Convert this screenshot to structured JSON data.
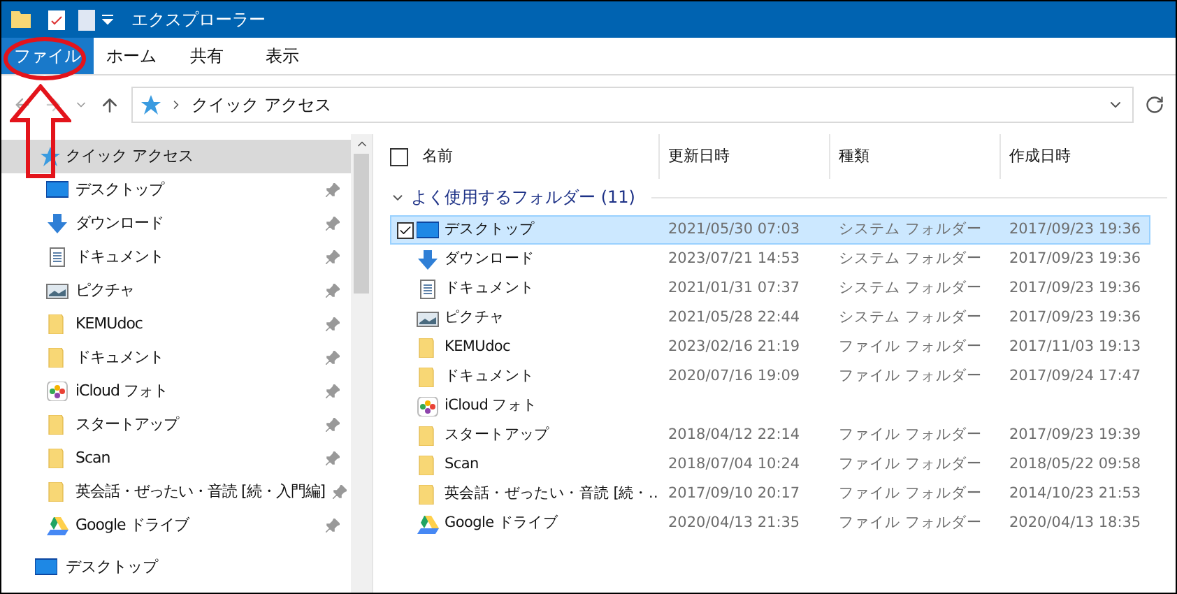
{
  "window": {
    "title": "エクスプローラー"
  },
  "ribbon_tabs": [
    {
      "label": "ファイル",
      "selected": true
    },
    {
      "label": "ホーム",
      "selected": false
    },
    {
      "label": "共有",
      "selected": false
    },
    {
      "label": "表示",
      "selected": false
    }
  ],
  "address_bar": {
    "path": "クイック アクセス"
  },
  "sidebar": {
    "header": {
      "label": "クイック アクセス",
      "selected": true
    },
    "items": [
      {
        "label": "デスクトップ",
        "kind": "desktop",
        "pinned": true
      },
      {
        "label": "ダウンロード",
        "kind": "download",
        "pinned": true
      },
      {
        "label": "ドキュメント",
        "kind": "document",
        "pinned": true
      },
      {
        "label": "ピクチャ",
        "kind": "picture",
        "pinned": true
      },
      {
        "label": "KEMUdoc",
        "kind": "folder",
        "pinned": true
      },
      {
        "label": "ドキュメント",
        "kind": "folder",
        "pinned": true
      },
      {
        "label": "iCloud フォト",
        "kind": "photos",
        "pinned": true
      },
      {
        "label": "スタートアップ",
        "kind": "folder",
        "pinned": true
      },
      {
        "label": "Scan",
        "kind": "folder",
        "pinned": true
      },
      {
        "label": "英会話・ぜったい・音読 [続・入門編]",
        "kind": "folder",
        "pinned": true
      },
      {
        "label": "Google ドライブ",
        "kind": "drive",
        "pinned": true
      }
    ],
    "footer": {
      "label": "デスクトップ",
      "kind": "desktop"
    }
  },
  "table": {
    "all_checked": false,
    "columns": [
      "名前",
      "更新日時",
      "種類",
      "作成日時"
    ],
    "group": "よく使用するフォルダー (11)",
    "rows": [
      {
        "name": "デスクトップ",
        "kind": "desktop",
        "modified": "2021/05/30 07:03",
        "type": "システム フォルダー",
        "created": "2017/09/23 19:36",
        "selected": true
      },
      {
        "name": "ダウンロード",
        "kind": "download",
        "modified": "2023/07/21 14:53",
        "type": "システム フォルダー",
        "created": "2017/09/23 19:36",
        "selected": false
      },
      {
        "name": "ドキュメント",
        "kind": "document",
        "modified": "2021/01/31 07:37",
        "type": "システム フォルダー",
        "created": "2017/09/23 19:36",
        "selected": false
      },
      {
        "name": "ピクチャ",
        "kind": "picture",
        "modified": "2021/05/28 22:44",
        "type": "システム フォルダー",
        "created": "2017/09/23 19:36",
        "selected": false
      },
      {
        "name": "KEMUdoc",
        "kind": "folder",
        "modified": "2023/02/16 21:19",
        "type": "ファイル フォルダー",
        "created": "2017/11/03 19:13",
        "selected": false
      },
      {
        "name": "ドキュメント",
        "kind": "folder",
        "modified": "2020/07/16 19:09",
        "type": "ファイル フォルダー",
        "created": "2017/09/24 17:47",
        "selected": false
      },
      {
        "name": "iCloud フォト",
        "kind": "photos",
        "selected": false
      },
      {
        "name": "スタートアップ",
        "kind": "folder",
        "modified": "2018/04/12 22:14",
        "type": "ファイル フォルダー",
        "created": "2017/09/23 19:39",
        "selected": false
      },
      {
        "name": "Scan",
        "kind": "folder",
        "modified": "2018/07/04 10:24",
        "type": "ファイル フォルダー",
        "created": "2018/05/22 09:58",
        "selected": false
      },
      {
        "name": "英会話・ぜったい・音読 [続・…",
        "kind": "folder",
        "modified": "2017/09/10 20:17",
        "type": "ファイル フォルダー",
        "created": "2014/10/23 21:53",
        "selected": false
      },
      {
        "name": "Google ドライブ",
        "kind": "drive",
        "modified": "2020/04/13 21:35",
        "type": "ファイル フォルダー",
        "created": "2020/04/13 18:35",
        "selected": false
      }
    ]
  }
}
